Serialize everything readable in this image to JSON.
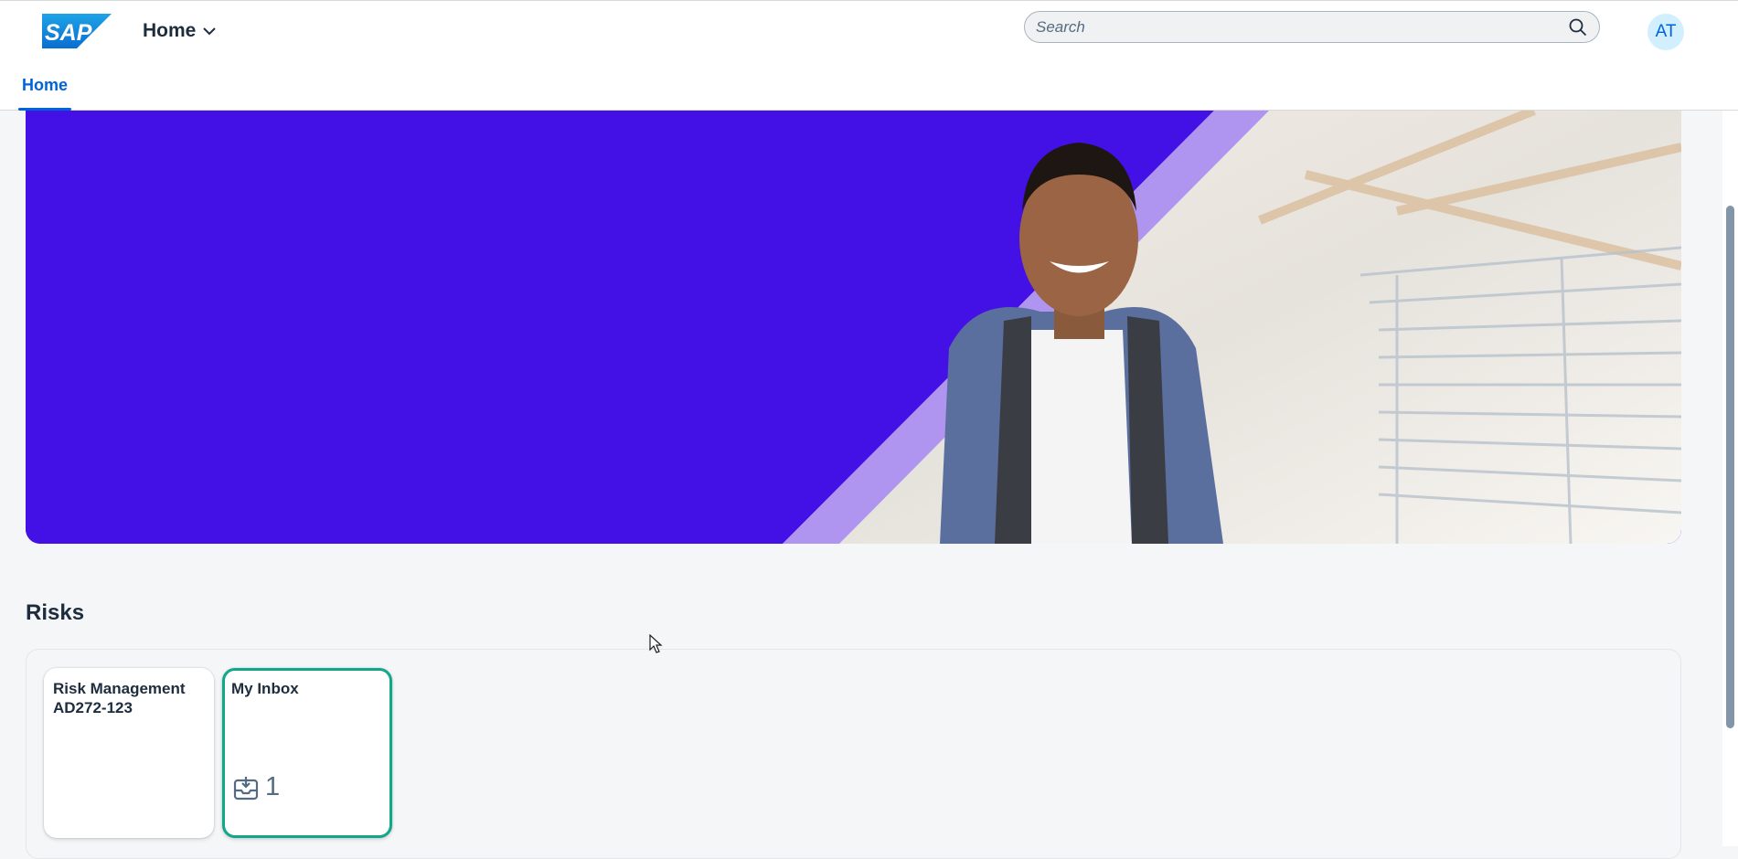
{
  "header": {
    "logo_text": "SAP",
    "home_menu_label": "Home",
    "search_placeholder": "Search",
    "avatar_initials": "AT"
  },
  "tabs": [
    {
      "label": "Home",
      "selected": true
    }
  ],
  "section": {
    "title": "Risks",
    "tiles": [
      {
        "title_line1": "Risk Management",
        "title_line2": "AD272-123"
      },
      {
        "title": "My Inbox",
        "count": "1"
      }
    ]
  },
  "colors": {
    "brand_blue": "#0064d9",
    "banner_purple": "#4310e6",
    "focus_green": "#10a88b",
    "sap_logo_blue": "#0a6ed1"
  }
}
